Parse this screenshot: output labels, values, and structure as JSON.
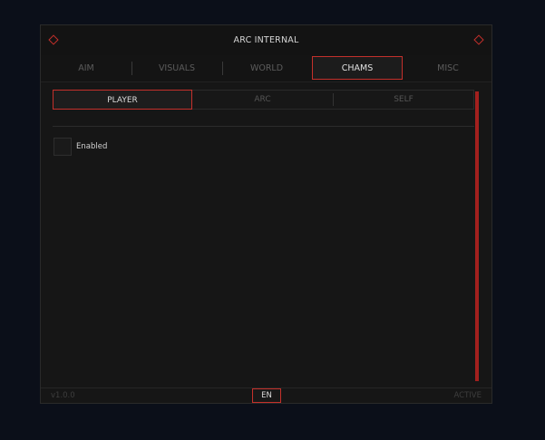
{
  "window": {
    "title": "ARC INTERNAL"
  },
  "tabs": [
    {
      "label": "AIM"
    },
    {
      "label": "VISUALS"
    },
    {
      "label": "WORLD"
    },
    {
      "label": "CHAMS",
      "active": true
    },
    {
      "label": "MISC"
    }
  ],
  "subtabs": [
    {
      "label": "PLAYER",
      "active": true
    },
    {
      "label": "ARC"
    },
    {
      "label": "SELF"
    }
  ],
  "options": {
    "enabled_label": "Enabled",
    "enabled_checked": false
  },
  "footer": {
    "version": "v1.0.0",
    "language": "EN",
    "status": "ACTIVE"
  },
  "colors": {
    "accent": "#c4302b",
    "background": "#0b0f19",
    "panel": "#161616"
  },
  "icons": {
    "title_left": "diamond-icon",
    "title_right": "diamond-icon"
  }
}
